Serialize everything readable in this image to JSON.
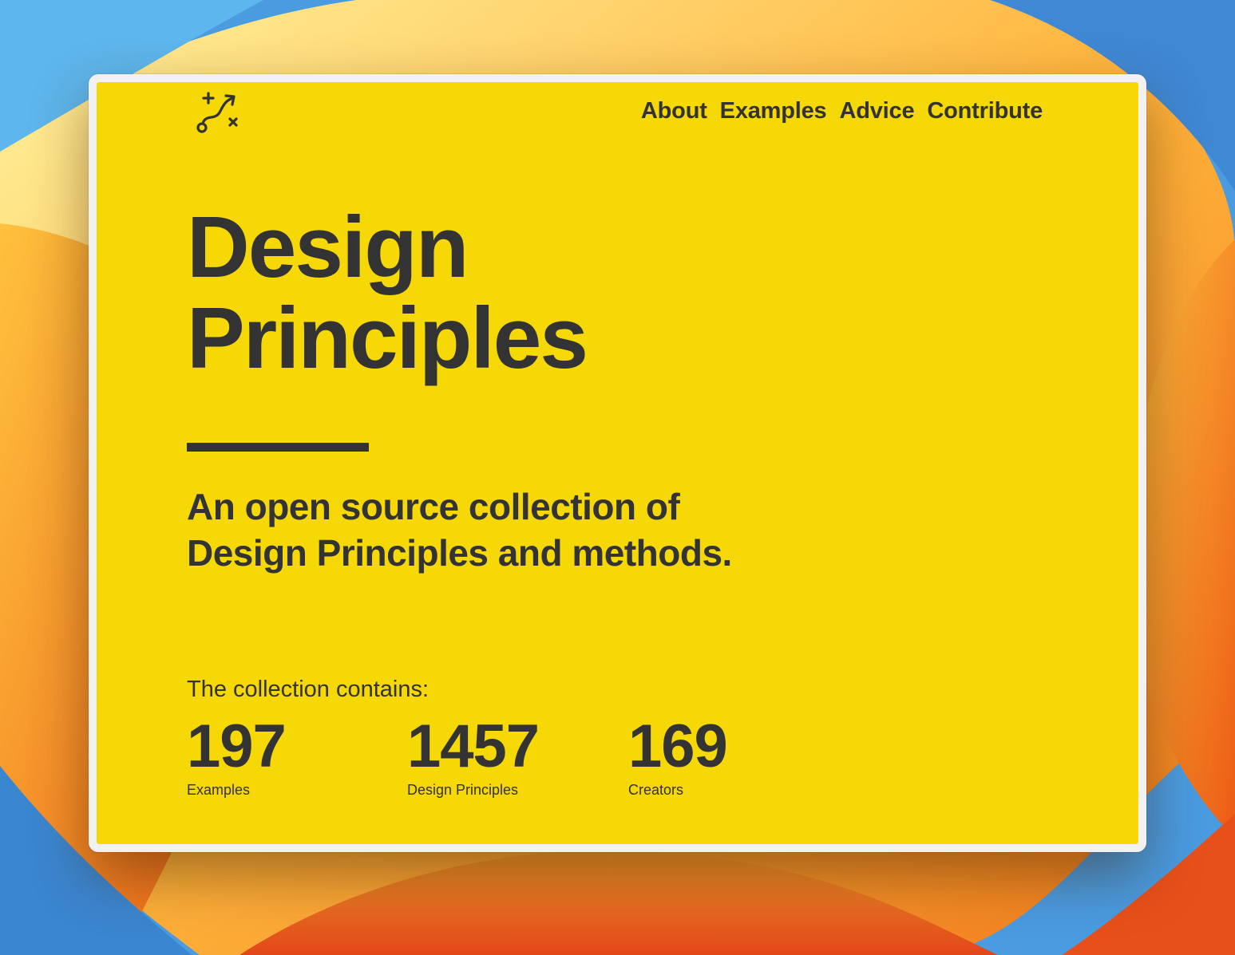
{
  "nav": {
    "items": [
      "About",
      "Examples",
      "Advice",
      "Contribute"
    ]
  },
  "hero": {
    "title_line1": "Design",
    "title_line2": "Principles",
    "tagline": "An open source collection of Design Principles and methods."
  },
  "stats": {
    "intro": "The collection contains:",
    "items": [
      {
        "value": "197",
        "label": "Examples"
      },
      {
        "value": "1457",
        "label": "Design Principles"
      },
      {
        "value": "169",
        "label": "Creators"
      }
    ]
  },
  "colors": {
    "page_background": "#f6d806",
    "text": "#333333",
    "window_frame": "#f1f1f1"
  },
  "icons": {
    "logo": "path-arrow-logo-icon"
  }
}
